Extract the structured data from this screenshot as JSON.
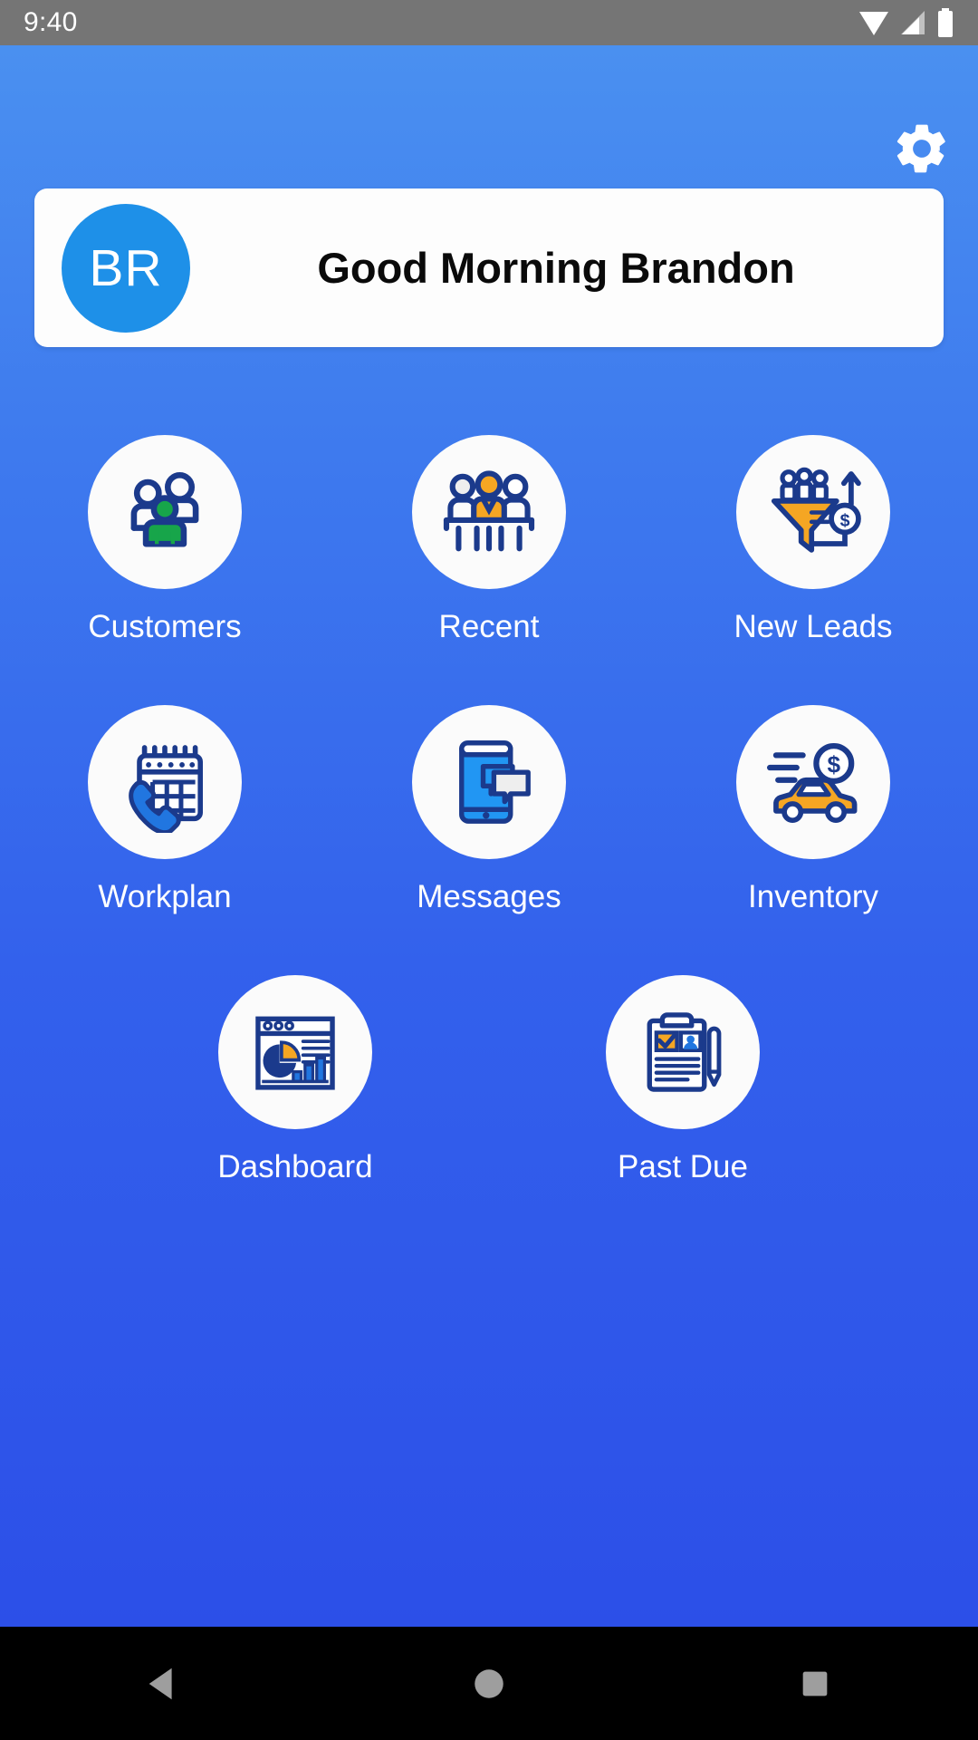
{
  "status_bar": {
    "time": "9:40",
    "icons": [
      "wifi-icon",
      "cell-signal-icon",
      "battery-icon"
    ],
    "background": "#757575"
  },
  "header": {
    "settings_icon": "gear-icon"
  },
  "greeting": {
    "avatar_initials": "BR",
    "avatar_color": "#1e90e8",
    "message": "Good Morning Brandon"
  },
  "theme": {
    "background_top": "#4a90f0",
    "background_bottom": "#2c4fe8",
    "icon_navy": "#1b3a8c",
    "icon_blue": "#2176e0",
    "icon_orange": "#f5a623",
    "icon_green": "#17a54a",
    "circle_white": "#fbfbfb"
  },
  "menu": {
    "rows": [
      [
        {
          "label": "Customers",
          "icon": "people-group-icon"
        },
        {
          "label": "Recent",
          "icon": "meeting-table-icon"
        },
        {
          "label": "New Leads",
          "icon": "sales-funnel-icon"
        }
      ],
      [
        {
          "label": "Workplan",
          "icon": "calendar-phone-icon"
        },
        {
          "label": "Messages",
          "icon": "phone-chat-icon"
        },
        {
          "label": "Inventory",
          "icon": "car-dollar-icon"
        }
      ],
      [
        {
          "label": "Dashboard",
          "icon": "analytics-window-icon"
        },
        {
          "label": "Past Due",
          "icon": "clipboard-pen-icon"
        }
      ]
    ]
  },
  "nav_bar": {
    "buttons": [
      {
        "name": "back-button",
        "icon": "triangle-back-icon"
      },
      {
        "name": "home-button",
        "icon": "circle-home-icon"
      },
      {
        "name": "recents-button",
        "icon": "square-recents-icon"
      }
    ]
  }
}
